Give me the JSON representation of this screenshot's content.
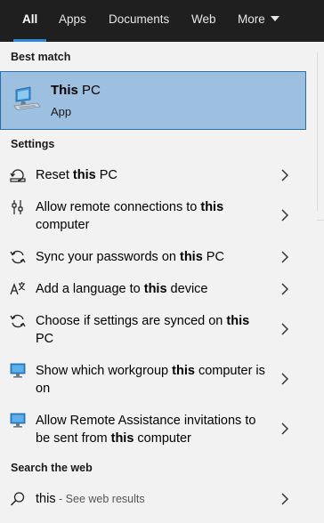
{
  "tabs": [
    {
      "label": "All"
    },
    {
      "label": "Apps"
    },
    {
      "label": "Documents"
    },
    {
      "label": "Web"
    },
    {
      "label": "More"
    }
  ],
  "best_match": {
    "section_title": "Best match",
    "title_bold": "This",
    "title_rest": " PC",
    "subtitle": "App",
    "icon": "this-pc-icon"
  },
  "settings": {
    "section_title": "Settings",
    "items": [
      {
        "before": "Reset ",
        "bold": "this",
        "after": " PC",
        "icon": "reset-pc-icon"
      },
      {
        "before": "Allow remote connections to ",
        "bold": "this",
        "after": " computer",
        "icon": "remote-connections-icon"
      },
      {
        "before": "Sync your passwords on ",
        "bold": "this",
        "after": " PC",
        "icon": "sync-icon"
      },
      {
        "before": "Add a language to ",
        "bold": "this",
        "after": " device",
        "icon": "language-icon"
      },
      {
        "before": "Choose if settings are synced on ",
        "bold": "this",
        "after": " PC",
        "icon": "sync-icon"
      },
      {
        "before": "Show which workgroup ",
        "bold": "this",
        "after": " computer is on",
        "icon": "monitor-icon"
      },
      {
        "before": "Allow Remote Assistance invitations to be sent from ",
        "bold": "this",
        "after": " computer",
        "icon": "monitor-icon"
      }
    ]
  },
  "web": {
    "section_title": "Search the web",
    "query": "this",
    "suffix": " - See web results",
    "icon": "search-icon"
  },
  "colors": {
    "tabbar_bg": "#1f1f1f",
    "accent": "#2b88d8",
    "selected_bg": "#9dbfe0",
    "panel_bg": "#f2f2f2"
  }
}
